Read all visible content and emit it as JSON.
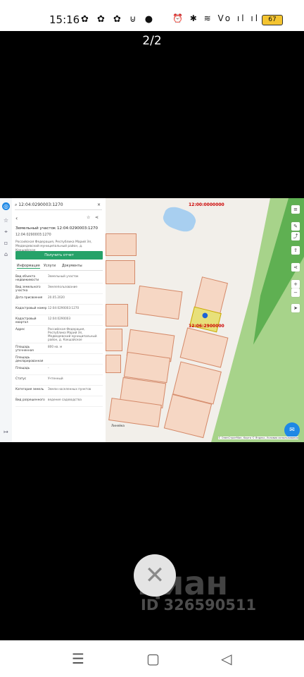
{
  "status_bar": {
    "time": "15:16",
    "left_icons": "✿ ✿ ✿ ⊍ ●",
    "right_icons": "⏰ ✱ ≋ Vo ıl ıl",
    "battery": "67"
  },
  "viewer": {
    "page_counter": "2/2"
  },
  "app": {
    "search_value": "12:04:0290003:1270",
    "title": "Земельный участок 12:04:0290003:1270",
    "subtitle": "12:04:0290003:1270",
    "address": "Российская Федерация, Республика Марий Эл, Медведевский муниципальный район, д. Кокшайское",
    "report_button": "Получить отчет",
    "tabs": [
      "Информация",
      "Услуги",
      "Документы"
    ],
    "rows": [
      {
        "k": "Вид объекта недвижимости",
        "v": "Земельный участок"
      },
      {
        "k": "Вид земельного участка",
        "v": "Землепользование"
      },
      {
        "k": "Дата присвоения",
        "v": "20.05.2020"
      },
      {
        "k": "Кадастровый номер",
        "v": "12:04:0290003:1270"
      },
      {
        "k": "Кадастровый квартал",
        "v": "12:04:0290003"
      },
      {
        "k": "Адрес",
        "v": "Российская Федерация, Республика Марий Эл, Медведевский муниципальный район, д. Кокшайское"
      },
      {
        "k": "Площадь уточненная",
        "v": "800 кв. м"
      },
      {
        "k": "Площадь декларированная",
        "v": ""
      },
      {
        "k": "Площадь",
        "v": "-"
      },
      {
        "k": "Статус",
        "v": "Учтенный"
      },
      {
        "k": "Категория земель",
        "v": "Земли населенных пунктов"
      },
      {
        "k": "Вид разрешенного",
        "v": "ведение садоводства"
      }
    ]
  },
  "map": {
    "label_top": "12:00:0000000",
    "label_sel": "12:06:2900000",
    "scale": "Линейка",
    "copyright": "© ОпенСтритМап, Карта © Яндекс, Условия использования",
    "buttons": [
      "layers-icon",
      "ruler-icon",
      "share-icon",
      "upload-icon",
      "navigation-icon",
      "plus-icon",
      "minus-icon",
      "locate-icon"
    ]
  },
  "watermark": {
    "brand": "циан",
    "id": "ID 326590511"
  },
  "colors": {
    "accent_green": "#26a269",
    "plot_fill": "#f6d7c4",
    "plot_border": "#d48a6a",
    "forest": "#a7d38a"
  }
}
